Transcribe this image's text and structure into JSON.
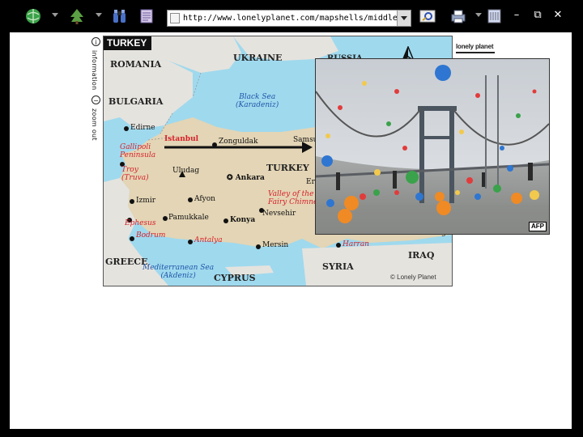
{
  "browser": {
    "address": "http://www.lonelyplanet.com/mapshells/middle_east/turkey/tu",
    "icons": [
      "globe-icon",
      "tree-icon",
      "binoculars-icon",
      "plan-icon",
      "address-page-icon",
      "search-icon",
      "printer-icon",
      "view-icon"
    ],
    "window_controls": {
      "minimize": "–",
      "restore": "⧉",
      "close": "✕"
    }
  },
  "side_controls": {
    "information": "information",
    "zoom_out": "zoom out"
  },
  "map": {
    "title": "TURKEY",
    "countries": {
      "romania": "ROMANIA",
      "ukraine": "UKRAINE",
      "bulgaria": "BULGARIA",
      "turkey": "TURKEY",
      "greece": "GREECE",
      "cyprus": "CYPRUS",
      "syria": "SYRIA",
      "iraq": "IRAQ",
      "russia_partial": "RUSSIA"
    },
    "seas": {
      "black_sea": "Black Sea",
      "black_sea_local": "(Karadeniz)",
      "med_sea": "Mediterranean Sea",
      "med_sea_local": "(Akdeniz)"
    },
    "cities": {
      "edirne": "Edirne",
      "istanbul": "Istanbul",
      "zonguldak": "Zonguldak",
      "samsun": "Samsu",
      "gallipoli": "Gallipoli",
      "gallipoli2": "Peninsula",
      "troy": "Troy",
      "troy2": "(Truva)",
      "uludag": "Uludag",
      "ankara": "Ankara",
      "izmir": "Izmir",
      "afyon": "Afyon",
      "ephesus": "Ephesus",
      "pamukkale": "Pamukkale",
      "konya": "Konya",
      "nevsehir": "Nevsehir",
      "bodrum": "Bodrum",
      "antalya": "Antalya",
      "mersin": "Mersin",
      "harran": "Harran",
      "valley": "Valley of the",
      "fairy": "Fairy Chimne",
      "er_partial": "Er",
      "bag_partial": "Bag"
    },
    "copyright": "© Lonely Planet",
    "brand": "lonely planet"
  },
  "photo": {
    "credit": "AFP"
  }
}
